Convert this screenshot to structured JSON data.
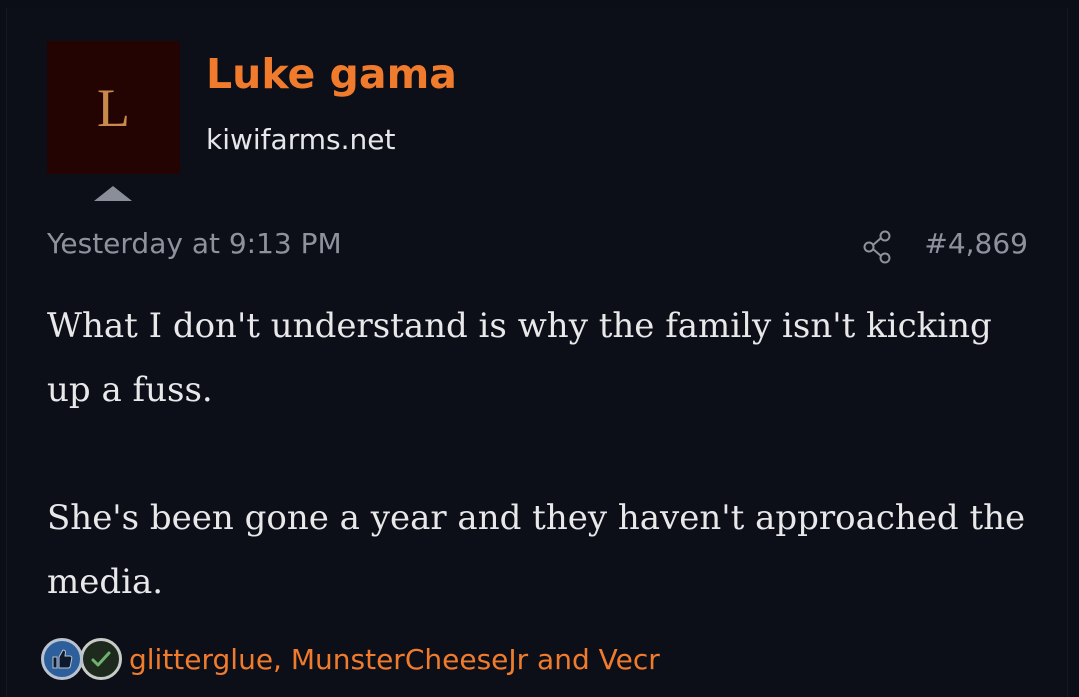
{
  "post": {
    "author_initial": "L",
    "author_name": "Luke gama",
    "author_site": "kiwifarms.net",
    "timestamp": "Yesterday at 9:13 PM",
    "post_number": "#4,869",
    "share_icon": "share-icon",
    "body": [
      "What I don't understand is why the family isn't kicking up a fuss.",
      "She's been gone a year and they haven't approached the media."
    ],
    "reactions": {
      "icons": [
        "like-icon",
        "agree-check-icon"
      ],
      "reactors_text": "glitterglue, MunsterCheeseJr and Vecr"
    }
  },
  "colors": {
    "background": "#0c0f17",
    "username": "#f07b2d",
    "avatar_bg": "#240402",
    "avatar_letter": "#c98b4c",
    "muted_text": "#8e929c",
    "body_text": "#e8e8ea",
    "like_reaction": "#2d5f9c",
    "agree_reaction": "#6db36d"
  }
}
